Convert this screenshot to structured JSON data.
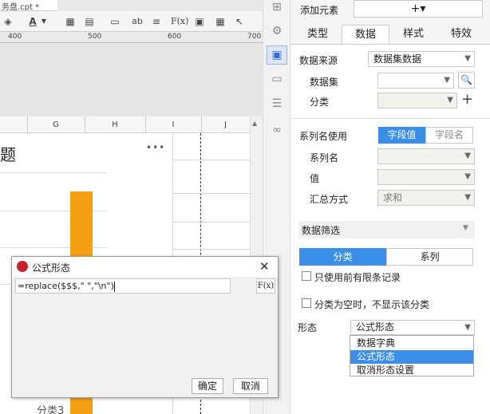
{
  "editor": {
    "tab_title": "务盘.cpt *",
    "toolbar": {
      "font_color_letter": "A",
      "ab_label": "ab",
      "formula_label": "F(x)"
    },
    "ruler_marks": [
      "400",
      "500",
      "600",
      "700"
    ],
    "columns": [
      "G",
      "H",
      "I",
      "J"
    ],
    "chart": {
      "title_fragment": "题",
      "more_label": "•••",
      "category_fragment": "分类3",
      "accent": "#f5a011"
    },
    "chart_data": {
      "type": "bar",
      "categories": [
        "分类3"
      ],
      "values": [],
      "title": "题"
    }
  },
  "dialog": {
    "title": "公式形态",
    "close_label": "✕",
    "formula_value": "=replace($$$,\" \",\"\\n\")",
    "fx_label": "F(x)",
    "ok_label": "确定",
    "cancel_label": "取消"
  },
  "panel": {
    "add_element_label": "添加元素",
    "add_symbol": "+▾",
    "tabs": [
      "类型",
      "数据",
      "样式",
      "特效"
    ],
    "active_tab": "数据",
    "data_source_label": "数据来源",
    "data_source_value": "数据集数据",
    "dataset_label": "数据集",
    "category_label": "分类",
    "series_name_use_label": "系列名使用",
    "toggle_field_value": "字段值",
    "toggle_field_name": "字段名",
    "series_name_label": "系列名",
    "value_label": "值",
    "summary_label": "汇总方式",
    "summary_value": "求和",
    "data_filter_label": "数据筛选",
    "filter_tabs": [
      "分类",
      "系列"
    ],
    "only_limited_label": "只使用前有限条记录",
    "hide_empty_label": "分类为空时，不显示该分类",
    "form_label": "形态",
    "form_value": "公式形态",
    "form_options": [
      "数据字典",
      "公式形态",
      "取消形态设置"
    ],
    "form_selected_index": 1,
    "accent": "#3a8ee6"
  }
}
